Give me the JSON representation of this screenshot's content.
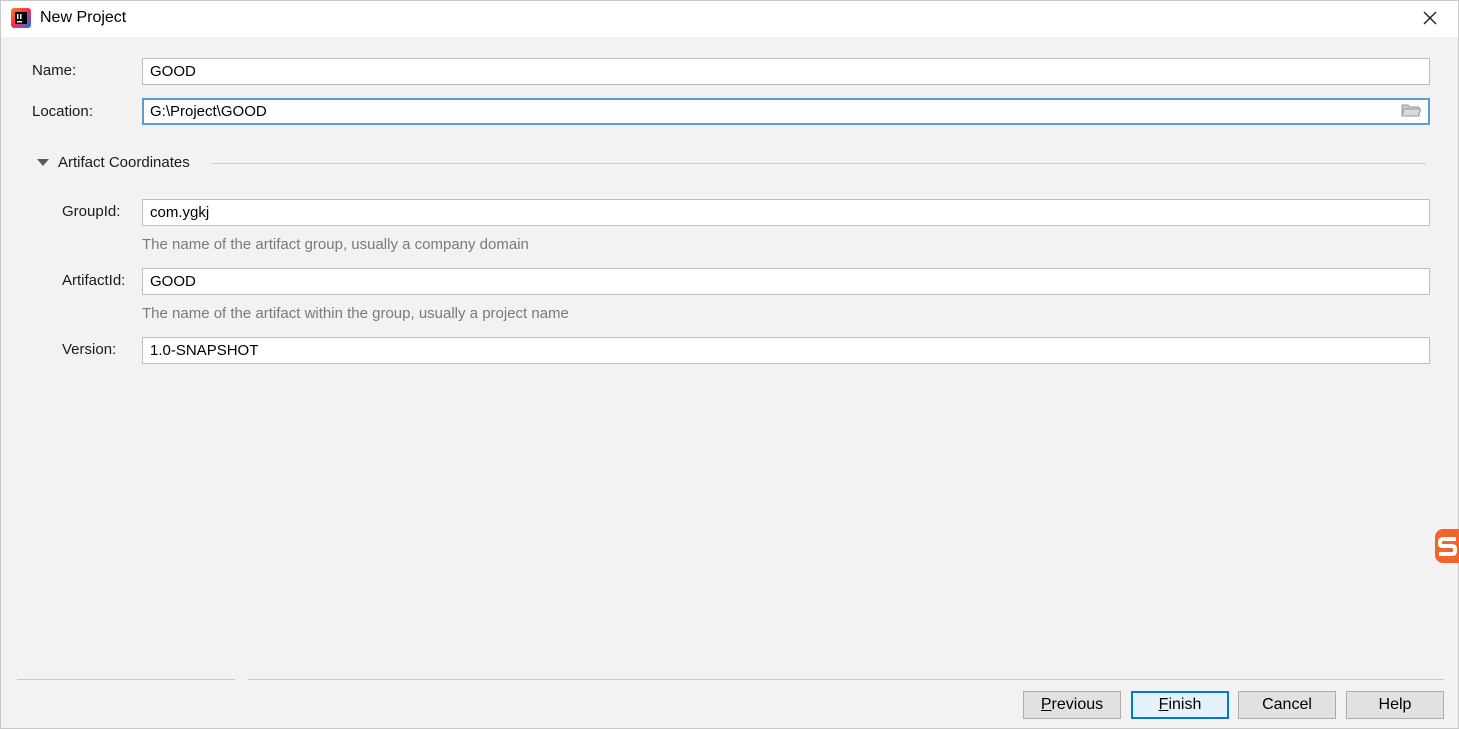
{
  "window": {
    "title": "New Project",
    "app_icon": "intellij-idea-icon",
    "close_icon": "close-icon"
  },
  "form": {
    "name": {
      "label": "Name:",
      "value": "GOOD"
    },
    "location": {
      "label": "Location:",
      "value": "G:\\Project\\GOOD",
      "browse_icon": "folder-icon"
    }
  },
  "artifact": {
    "section_title": "Artifact Coordinates",
    "expanded": true,
    "group_id": {
      "label": "GroupId:",
      "value": "com.ygkj",
      "hint": "The name of the artifact group, usually a company domain"
    },
    "artifact_id": {
      "label": "ArtifactId:",
      "value": "GOOD",
      "hint": "The name of the artifact within the group, usually a project name"
    },
    "version": {
      "label": "Version:",
      "value": "1.0-SNAPSHOT"
    }
  },
  "buttons": {
    "previous": {
      "mnemonic": "P",
      "rest": "revious"
    },
    "finish": {
      "mnemonic": "F",
      "rest": "inish"
    },
    "cancel": "Cancel",
    "help": "Help"
  },
  "colors": {
    "focus_border": "#5b9bd5",
    "default_button_border": "#0078d7",
    "background": "#f2f2f2"
  }
}
